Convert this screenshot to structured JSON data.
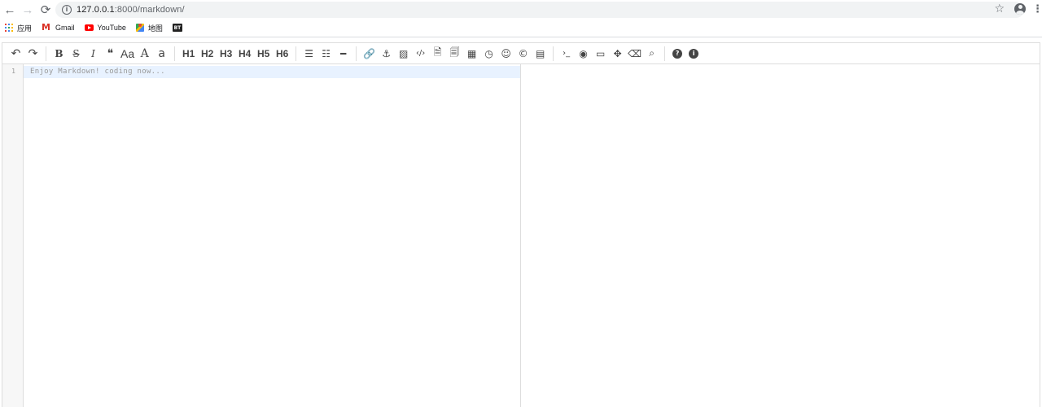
{
  "browser": {
    "url_host": "127.0.0.1",
    "url_path": ":8000/markdown/",
    "bookmarks": [
      {
        "label": "应用",
        "icon": "apps-icon"
      },
      {
        "label": "Gmail",
        "icon": "gmail-icon"
      },
      {
        "label": "YouTube",
        "icon": "youtube-icon"
      },
      {
        "label": "地图",
        "icon": "maps-icon"
      },
      {
        "label": "",
        "icon": "bt-icon",
        "badge": "BT"
      }
    ]
  },
  "toolbar": {
    "undo": "↶",
    "redo": "↷",
    "bold": "B",
    "strike": "S",
    "italic": "I",
    "quote": "❝",
    "uppercase": "Aa",
    "upper": "A",
    "lower": "a",
    "h1": "H1",
    "h2": "H2",
    "h3": "H3",
    "h4": "H4",
    "h5": "H5",
    "h6": "H6",
    "ul": "☰",
    "ol": "☷",
    "hr": "━",
    "link": "🔗",
    "anchor": "⚓",
    "image": "▨",
    "code": "‹/›",
    "preformatted": "🗎",
    "code_block": "🗐",
    "table": "▦",
    "datetime": "◷",
    "emoji": "☺",
    "html_entities": "©",
    "pagebreak": "▤",
    "goto_line": "›_",
    "watch": "◉",
    "preview": "▭",
    "fullscreen": "✥",
    "clear": "⌫",
    "search": "⌕",
    "help": "?",
    "info": "i"
  },
  "editor": {
    "line_number": "1",
    "placeholder": "Enjoy Markdown! coding now..."
  },
  "colors": {
    "active_line": "#e8f2ff",
    "gutter": "#f7f7f7",
    "border": "#dddddd"
  }
}
